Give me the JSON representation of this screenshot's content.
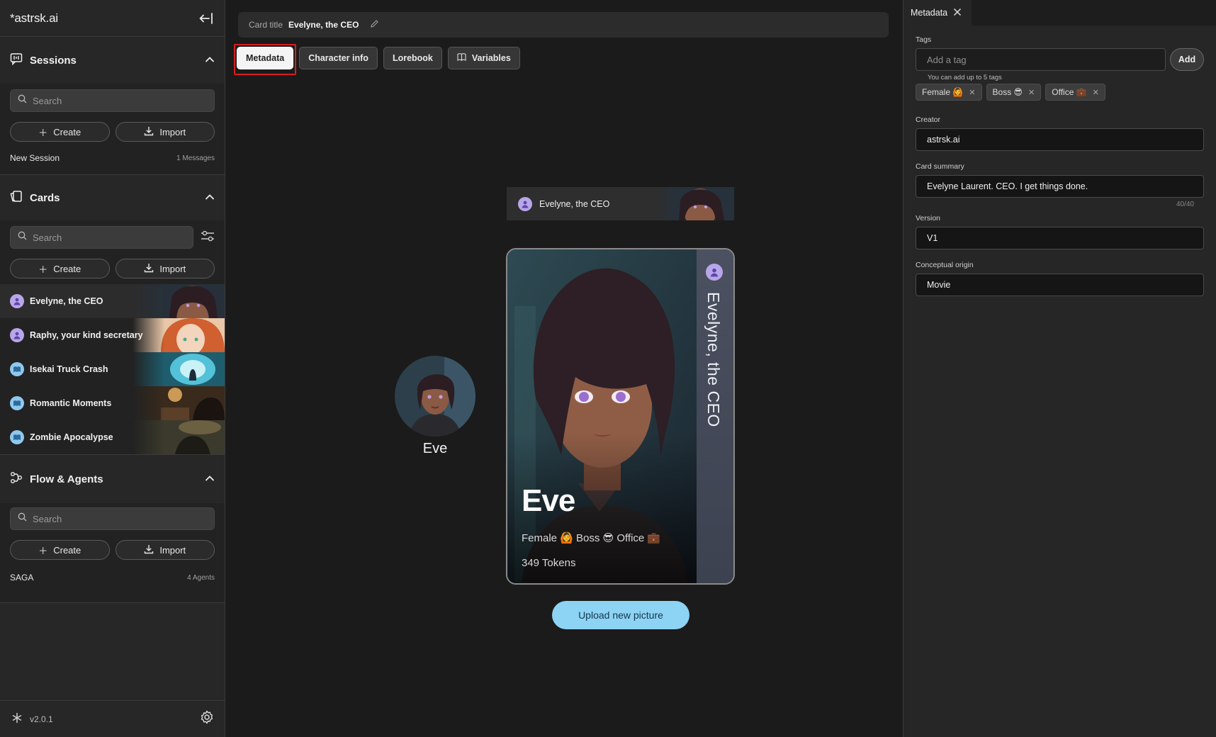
{
  "sidebar": {
    "brand": "*astrsk.ai",
    "sessions": {
      "title": "Sessions",
      "search_placeholder": "Search",
      "create_label": "Create",
      "import_label": "Import",
      "items": [
        {
          "name": "New Session",
          "meta": "1 Messages"
        }
      ]
    },
    "cards": {
      "title": "Cards",
      "search_placeholder": "Search",
      "create_label": "Create",
      "import_label": "Import",
      "items": [
        {
          "name": "Evelyne, the CEO",
          "kind": "character"
        },
        {
          "name": "Raphy, your kind secretary",
          "kind": "character"
        },
        {
          "name": "Isekai Truck Crash",
          "kind": "plot"
        },
        {
          "name": "Romantic Moments",
          "kind": "plot"
        },
        {
          "name": "Zombie Apocalypse",
          "kind": "plot"
        }
      ]
    },
    "flows": {
      "title": "Flow & Agents",
      "search_placeholder": "Search",
      "create_label": "Create",
      "import_label": "Import",
      "items": [
        {
          "name": "SAGA",
          "meta": "4 Agents"
        }
      ]
    },
    "version": "v2.0.1"
  },
  "main": {
    "card_title_label": "Card title",
    "card_title_value": "Evelyne, the CEO",
    "tabs": [
      {
        "label": "Metadata",
        "active": true
      },
      {
        "label": "Character info",
        "active": false
      },
      {
        "label": "Lorebook",
        "active": false
      },
      {
        "label": "Variables",
        "active": false
      }
    ],
    "mini_card_name": "Evelyne, the CEO",
    "avatar_name": "Eve",
    "card": {
      "spine_title": "Evelyne, the CEO",
      "name": "Eve",
      "tags_line": "Female 🙆 Boss 😎 Office 💼",
      "tokens": "349 Tokens"
    },
    "upload_label": "Upload new picture"
  },
  "panel": {
    "tab_label": "Metadata",
    "tags_label": "Tags",
    "tag_placeholder": "Add a tag",
    "add_label": "Add",
    "tags_hint": "You can add up to 5 tags",
    "tags": [
      "Female 🙆",
      "Boss 😎",
      "Office 💼"
    ],
    "creator_label": "Creator",
    "creator_value": "astrsk.ai",
    "summary_label": "Card summary",
    "summary_value": "Evelyne Laurent. CEO. I get things done.",
    "summary_counter": "40/40",
    "version_label": "Version",
    "version_value": "V1",
    "origin_label": "Conceptual origin",
    "origin_value": "Movie"
  },
  "colors": {
    "accent": "#8dd3f4",
    "character_avatar": "#b9a5ea",
    "plot_avatar": "#8fc8ef",
    "highlight": "#d81e1e"
  }
}
